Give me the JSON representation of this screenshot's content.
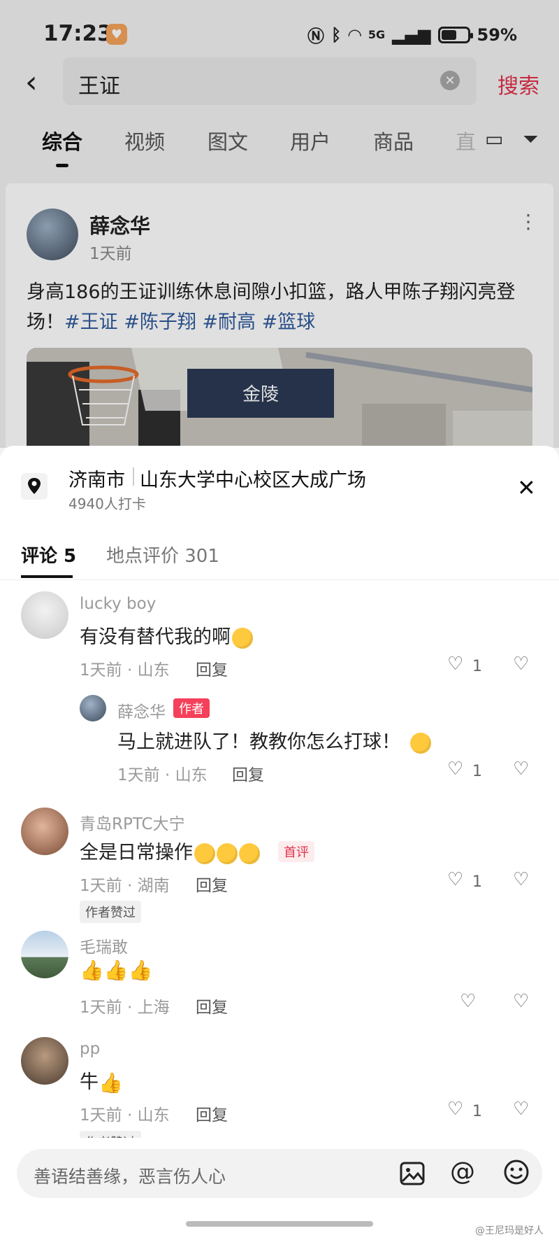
{
  "status": {
    "time": "17:23",
    "network": "5G",
    "battery": "59%",
    "battery_level": 0.59
  },
  "search": {
    "query": "王证",
    "submit_label": "搜索"
  },
  "tabs": {
    "items": [
      "综合",
      "视频",
      "图文",
      "用户",
      "商品"
    ],
    "faded": "直",
    "active_index": 0
  },
  "post": {
    "author": "薛念华",
    "time": "1天前",
    "text": "身高186的王证训练休息间隙小扣篮，路人甲陈子翔闪亮登场！",
    "tags": [
      "#王证",
      "#陈子翔",
      "#耐高",
      "#篮球"
    ],
    "image_sign": "金陵"
  },
  "location": {
    "city": "济南市",
    "place": "山东大学中心校区大成广场",
    "checkins": "4940人打卡"
  },
  "sheet_tabs": {
    "comments": "评论 5",
    "reviews": "地点评价 301"
  },
  "comments": [
    {
      "name": "lucky  boy",
      "text": "有没有替代我的啊",
      "meta": "1天前 · 山东",
      "reply": "回复",
      "likes": "1"
    },
    {
      "name": "薛念华",
      "badge": "作者",
      "text": "马上就进队了！教教你怎么打球！",
      "meta": "1天前 · 山东",
      "reply": "回复",
      "likes": "1"
    },
    {
      "name": "青岛RPTC大宁",
      "text": "全是日常操作",
      "badge": "首评",
      "meta": "1天前 · 湖南",
      "reply": "回复",
      "likes": "1",
      "tag": "作者赞过"
    },
    {
      "name": "毛瑞敢",
      "text": "",
      "meta": "1天前 · 上海",
      "reply": "回复",
      "likes": ""
    },
    {
      "name": "pp",
      "text": "牛",
      "meta": "1天前 · 山东",
      "reply": "回复",
      "likes": "1",
      "tag": "作者赞过"
    }
  ],
  "input": {
    "placeholder": "善语结善缘，恶言伤人心"
  },
  "watermark": "@王尼玛是好人"
}
